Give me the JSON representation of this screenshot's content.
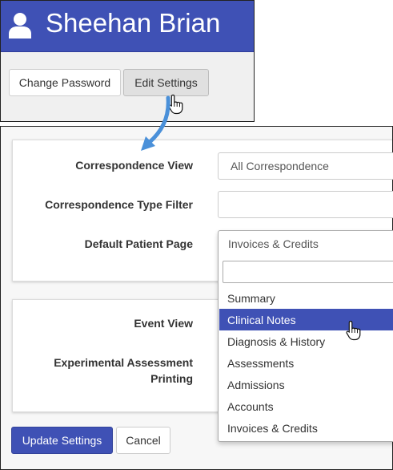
{
  "colors": {
    "brand": "#3f51b5",
    "header_text": "#ffffff",
    "arrow": "#4a90d9"
  },
  "header": {
    "user_name": "Sheehan Brian",
    "icon": "user-icon"
  },
  "toolbar": {
    "change_password_label": "Change Password",
    "edit_settings_label": "Edit Settings"
  },
  "settings": {
    "correspondence_view": {
      "label": "Correspondence View",
      "value": "All Correspondence"
    },
    "correspondence_type_filter": {
      "label": "Correspondence Type Filter",
      "value": ""
    },
    "default_patient_page": {
      "label": "Default Patient Page",
      "value": "Invoices & Credits",
      "search_value": "",
      "options": [
        "Summary",
        "Clinical Notes",
        "Diagnosis & History",
        "Assessments",
        "Admissions",
        "Accounts",
        "Invoices & Credits"
      ],
      "highlighted_option": "Clinical Notes"
    },
    "event_view": {
      "label": "Event View"
    },
    "experimental_assessment_printing": {
      "label_line1": "Experimental Assessment",
      "label_line2": "Printing"
    }
  },
  "footer": {
    "update_label": "Update Settings",
    "cancel_label": "Cancel"
  }
}
